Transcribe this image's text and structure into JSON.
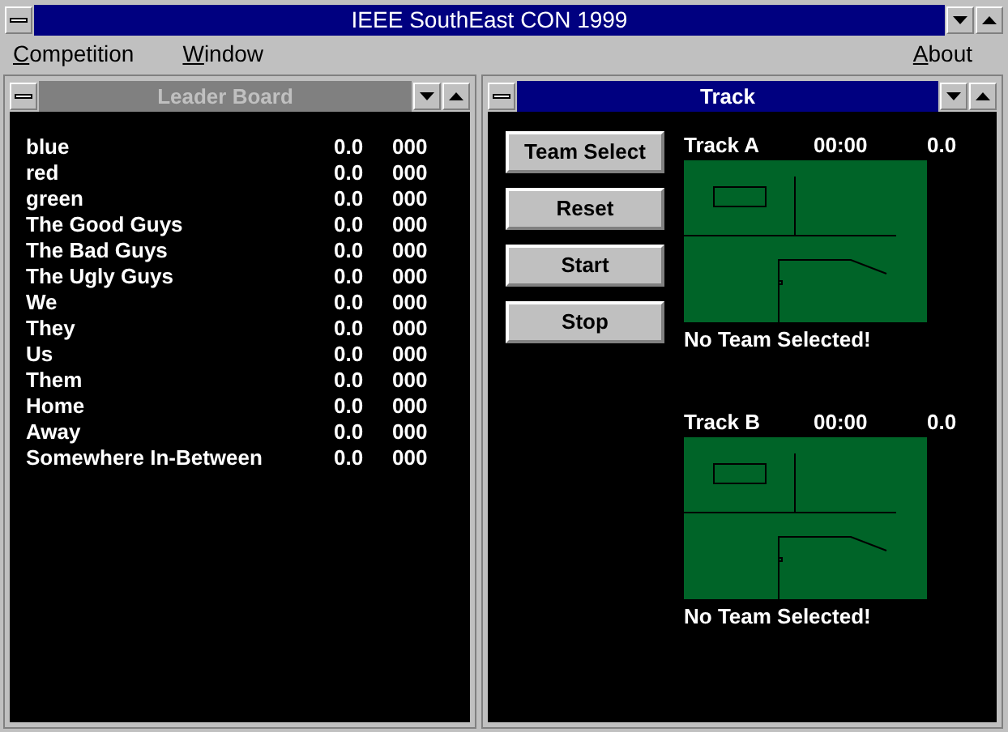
{
  "window": {
    "title": "IEEE SouthEast CON 1999"
  },
  "menu": [
    {
      "label": "Competition"
    },
    {
      "label": "Window"
    },
    {
      "label": "About"
    }
  ],
  "leader_board": {
    "title": "Leader Board",
    "active": false,
    "rows": [
      {
        "team": "blue",
        "score": "0.0",
        "count": "000"
      },
      {
        "team": "red",
        "score": "0.0",
        "count": "000"
      },
      {
        "team": "green",
        "score": "0.0",
        "count": "000"
      },
      {
        "team": "The Good Guys",
        "score": "0.0",
        "count": "000"
      },
      {
        "team": "The Bad Guys",
        "score": "0.0",
        "count": "000"
      },
      {
        "team": "The Ugly Guys",
        "score": "0.0",
        "count": "000"
      },
      {
        "team": "We",
        "score": "0.0",
        "count": "000"
      },
      {
        "team": "They",
        "score": "0.0",
        "count": "000"
      },
      {
        "team": "Us",
        "score": "0.0",
        "count": "000"
      },
      {
        "team": "Them",
        "score": "0.0",
        "count": "000"
      },
      {
        "team": "Home",
        "score": "0.0",
        "count": "000"
      },
      {
        "team": "Away",
        "score": "0.0",
        "count": "000"
      },
      {
        "team": "Somewhere In-Between",
        "score": "0.0",
        "count": "000"
      }
    ]
  },
  "track_window": {
    "title": "Track",
    "active": true,
    "buttons": [
      "Team Select",
      "Reset",
      "Start",
      "Stop"
    ],
    "tracks": [
      {
        "name": "Track A",
        "time": "00:00",
        "score": "0.0",
        "status": "No Team Selected!"
      },
      {
        "name": "Track B",
        "time": "00:00",
        "score": "0.0",
        "status": "No Team Selected!"
      }
    ]
  }
}
